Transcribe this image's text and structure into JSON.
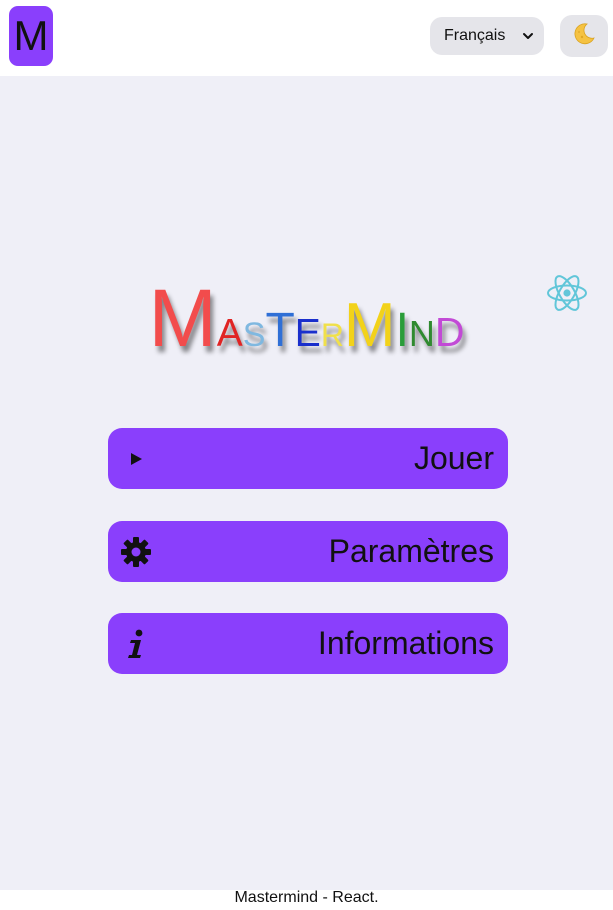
{
  "header": {
    "logo_letter": "M",
    "language_selected": "Français",
    "theme_toggle_icon": "moon-icon"
  },
  "title": {
    "letters": [
      {
        "char": "M",
        "size": "big",
        "color": "#f24c4c"
      },
      {
        "char": "A",
        "size": "small",
        "color": "#e02424"
      },
      {
        "char": "S",
        "size": "small",
        "color": "#7fb8e0"
      },
      {
        "char": "T",
        "size": "big-mid",
        "color": "#2f6fd6"
      },
      {
        "char": "E",
        "size": "small",
        "color": "#1a2fcc"
      },
      {
        "char": "R",
        "size": "small",
        "color": "#f0e04a"
      },
      {
        "char": "M",
        "size": "big",
        "color": "#f2d21a"
      },
      {
        "char": "I",
        "size": "mid",
        "color": "#2a9d3a"
      },
      {
        "char": "N",
        "size": "small",
        "color": "#2f8a2f"
      },
      {
        "char": "D",
        "size": "small",
        "color": "#c24ad6"
      }
    ]
  },
  "menu": {
    "play_label": "Jouer",
    "play_icon": "play-icon",
    "settings_label": "Paramètres",
    "settings_icon": "gear-icon",
    "info_label": "Informations",
    "info_icon": "info-icon"
  },
  "side_icon": "react-icon",
  "footer": {
    "text": "Mastermind - React."
  },
  "colors": {
    "accent": "#8a3ffc",
    "background": "#efeff7",
    "control_bg": "#e5e5ea"
  }
}
